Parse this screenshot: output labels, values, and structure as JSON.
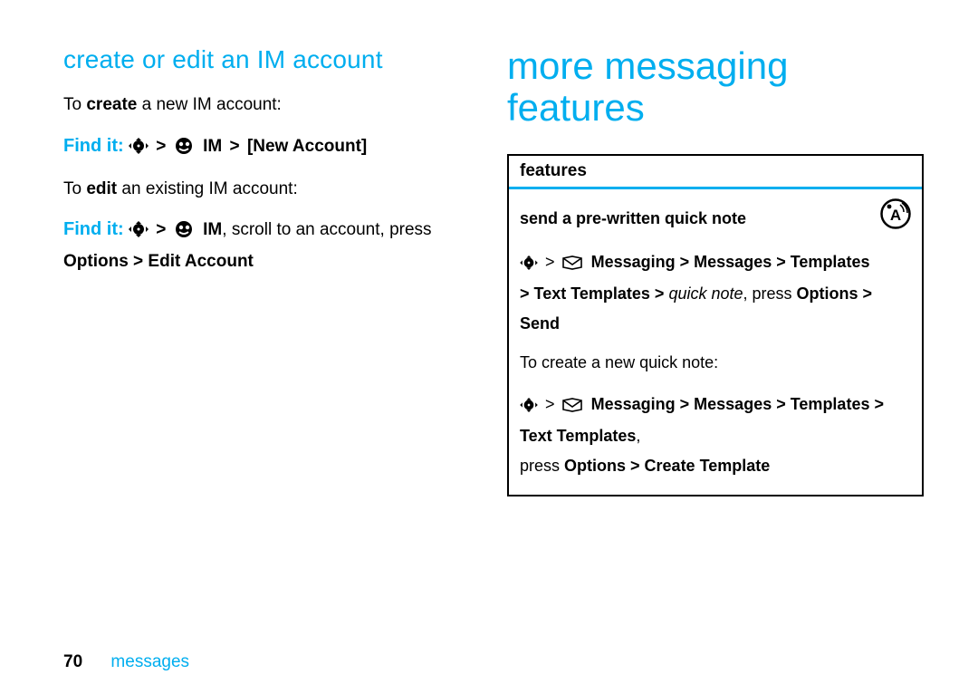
{
  "left": {
    "heading": "create or edit an IM account",
    "create_to": "To ",
    "create_bold": "create",
    "create_rest": " a new IM account:",
    "find_it": "Find it:",
    "gt": ">",
    "im_label": "IM",
    "new_account": "[New Account]",
    "edit_to": "To ",
    "edit_bold": "edit",
    "edit_rest": " an existing IM account:",
    "scroll_text": ", scroll to an account, press ",
    "options_edit": "Options > Edit Account"
  },
  "right": {
    "heading": "more messaging features",
    "table_header": "features",
    "feature_title": "send a pre-written quick note",
    "msg_label": "Messaging",
    "messages_label": "Messages",
    "templates_label": "Templates",
    "text_templates_label": "Text Templates",
    "quick_note": "quick note",
    "press": ", press ",
    "options_send": "Options > Send",
    "create_note_intro": "To create a new quick note:",
    "press2": "press ",
    "options_create": "Options > Create Template",
    "comma": ", "
  },
  "footer": {
    "page": "70",
    "label": "messages"
  }
}
